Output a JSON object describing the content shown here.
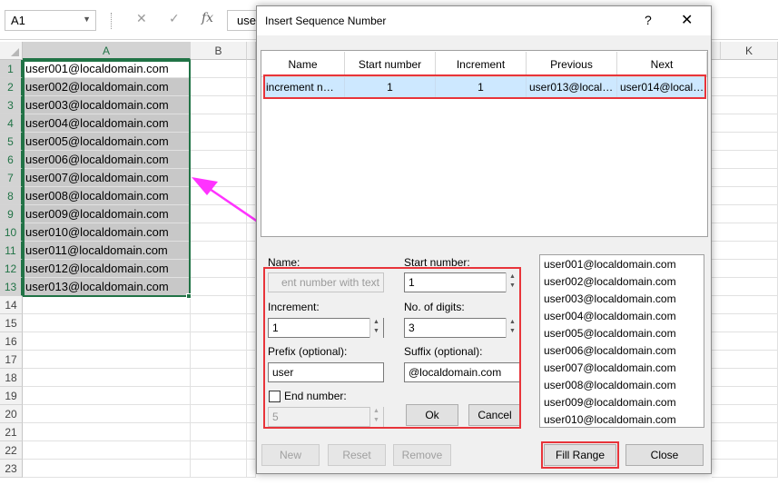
{
  "excel": {
    "name_box": "A1",
    "formula_value": "use",
    "columns": [
      "A",
      "B",
      "K"
    ],
    "rows": [
      "1",
      "2",
      "3",
      "4",
      "5",
      "6",
      "7",
      "8",
      "9",
      "10",
      "11",
      "12",
      "13",
      "14",
      "15",
      "16",
      "17",
      "18",
      "19",
      "20",
      "21",
      "22",
      "23"
    ],
    "cells_a": [
      "user001@localdomain.com",
      "user002@localdomain.com",
      "user003@localdomain.com",
      "user004@localdomain.com",
      "user005@localdomain.com",
      "user006@localdomain.com",
      "user007@localdomain.com",
      "user008@localdomain.com",
      "user009@localdomain.com",
      "user010@localdomain.com",
      "user011@localdomain.com",
      "user012@localdomain.com",
      "user013@localdomain.com"
    ],
    "selection_color": "#217346"
  },
  "dialog": {
    "title": "Insert Sequence Number",
    "help_label": "?",
    "close_glyph": "✕",
    "table": {
      "headers": [
        "Name",
        "Start number",
        "Increment",
        "Previous",
        "Next"
      ],
      "row": [
        "increment n…",
        "1",
        "1",
        "user013@local…",
        "user014@local…"
      ]
    },
    "form": {
      "name_label": "Name:",
      "name_value": "ent number with text",
      "start_label": "Start number:",
      "start_value": "1",
      "increment_label": "Increment:",
      "increment_value": "1",
      "digits_label": "No. of digits:",
      "digits_value": "3",
      "prefix_label": "Prefix (optional):",
      "prefix_value": "user",
      "suffix_label": "Suffix (optional):",
      "suffix_value": "@localdomain.com",
      "end_label": "End number:",
      "end_value": "5",
      "ok_label": "Ok",
      "cancel_label": "Cancel"
    },
    "preview": [
      "user001@localdomain.com",
      "user002@localdomain.com",
      "user003@localdomain.com",
      "user004@localdomain.com",
      "user005@localdomain.com",
      "user006@localdomain.com",
      "user007@localdomain.com",
      "user008@localdomain.com",
      "user009@localdomain.com",
      "user010@localdomain.com"
    ],
    "buttons": {
      "new": "New",
      "reset": "Reset",
      "remove": "Remove",
      "fill_range": "Fill Range",
      "close": "Close"
    },
    "highlight_color": "#e8343a",
    "arrow_color": "#ff33ff"
  }
}
